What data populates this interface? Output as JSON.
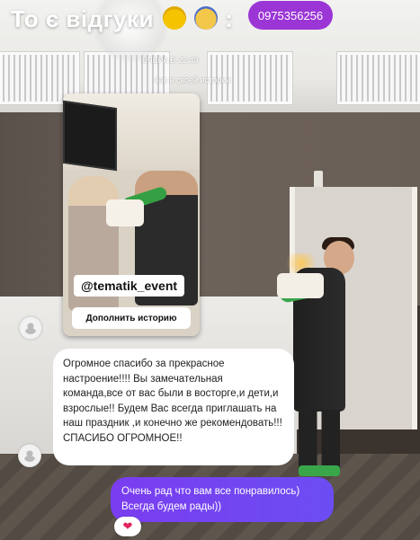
{
  "header": {
    "title": "То є відгуки",
    "title_emojis": [
      "star-struck-emoji-icon",
      "screaming-face-emoji-icon"
    ],
    "separator": ":",
    "phone": "0975356256"
  },
  "story_meta": {
    "line1": "ВЧЕРА В 22:49",
    "line2": "вас в своей истории"
  },
  "story_card": {
    "tag": "@tematik_event",
    "add_button_label": "Дополнить историю"
  },
  "messages": [
    {
      "direction": "incoming",
      "text": "Огромное спасибо за прекрасное настроение!!!! Вы замечательная команда,все от вас были в восторге,и дети,и взрослые!! Будем Вас всегда приглашать на наш праздник ,и конечно же рекомендовать!!! СПАСИБО ОГРОМНОЕ!!"
    },
    {
      "direction": "outgoing",
      "text": "Очень рад что вам все понравилось) Всегда будем рады))",
      "reaction": "❤"
    }
  ],
  "colors": {
    "accent_purple": "#9b35d6",
    "outgoing_bubble": "#7a3df0",
    "incoming_bubble": "#ffffff"
  }
}
